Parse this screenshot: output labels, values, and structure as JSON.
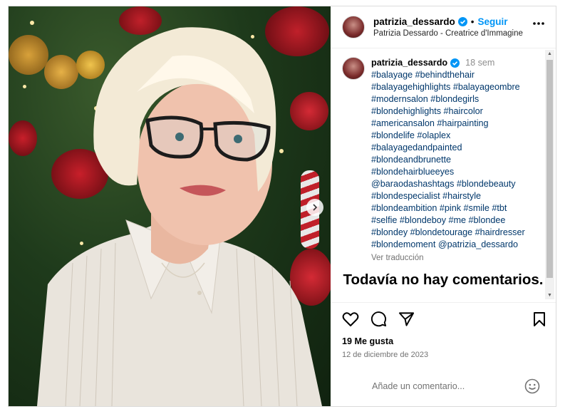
{
  "post": {
    "username": "patrizia_dessardo",
    "follow_label": "Seguir",
    "subtitle": "Patrizia Dessardo - Creatrice d'Immagine",
    "caption_time": "18 sem",
    "caption_tags": "#balayage #behindthehair\n#balayagehighlights #balayageombre\n#modernsalon #blondegirls\n#blondehighlights #haircolor\n#americansalon #hairpainting\n#blondelife #olaplex\n#balayagedandpainted\n#blondeandbrunette\n#blondehairblueeyes\n@baraodashashtags #blondebeauty\n#blondespecialist #hairstyle\n#blondeambition #pink #smile #tbt\n#selfie #blondeboy #me #blondee\n#blondey #blondetourage #hairdresser\n#blondemoment @patrizia_dessardo",
    "translate_label": "Ver traducción",
    "no_comments": "Todavía no hay comentarios.",
    "likes": "19 Me gusta",
    "date": "12 de diciembre de 2023",
    "comment_placeholder": "Añade un comentario..."
  },
  "icons": {
    "verified": "verified-badge-icon",
    "more": "more-options-icon",
    "like": "heart-icon",
    "comment": "comment-bubble-icon",
    "share": "paper-plane-icon",
    "save": "bookmark-icon",
    "emoji": "smiley-emoji-icon",
    "next": "chevron-right-icon"
  },
  "colors": {
    "accent": "#0095f6",
    "tag_link": "#00376b",
    "muted": "#737373"
  }
}
